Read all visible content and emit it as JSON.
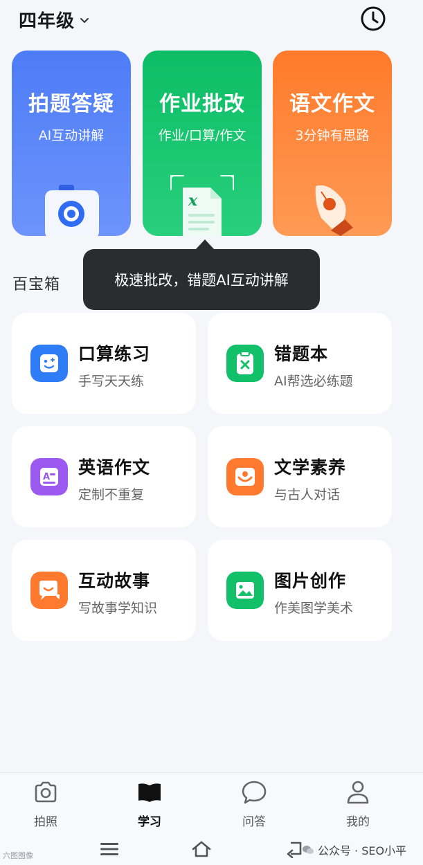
{
  "header": {
    "grade": "四年级",
    "chevron_icon": "chevron-down-icon",
    "history_icon": "clock-icon"
  },
  "features": [
    {
      "title": "拍题答疑",
      "subtitle": "AI互动讲解",
      "color": "#5a86f9",
      "icon": "camera-icon"
    },
    {
      "title": "作业批改",
      "subtitle": "作业/口算/作文",
      "color": "#17c46f",
      "icon": "scan-document-icon"
    },
    {
      "title": "语文作文",
      "subtitle": "3分钟有思路",
      "color": "#ff8438",
      "icon": "pen-nib-icon"
    }
  ],
  "tooltip": {
    "text": "极速批改，错题AI互动讲解"
  },
  "section": {
    "title": "百宝箱"
  },
  "tools": [
    {
      "title": "口算练习",
      "subtitle": "手写天天练",
      "color": "#2e7cf6",
      "icon": "smile-face-icon"
    },
    {
      "title": "错题本",
      "subtitle": "AI帮选必练题",
      "color": "#12c06a",
      "icon": "clipboard-x-icon"
    },
    {
      "title": "英语作文",
      "subtitle": "定制不重复",
      "color": "#9b59f0",
      "icon": "letter-a-icon"
    },
    {
      "title": "文学素养",
      "subtitle": "与古人对话",
      "color": "#ff7a2e",
      "icon": "book-open-icon"
    },
    {
      "title": "互动故事",
      "subtitle": "写故事学知识",
      "color": "#ff7a2e",
      "icon": "chat-bubbles-icon"
    },
    {
      "title": "图片创作",
      "subtitle": "作美图学美术",
      "color": "#12c06a",
      "icon": "image-icon"
    }
  ],
  "tabbar": {
    "items": [
      {
        "label": "拍照",
        "icon": "camera-icon",
        "active": false
      },
      {
        "label": "学习",
        "icon": "book-icon",
        "active": true
      },
      {
        "label": "问答",
        "icon": "chat-icon",
        "active": false
      },
      {
        "label": "我的",
        "icon": "person-icon",
        "active": false
      }
    ]
  },
  "watermarks": {
    "left": "六图图像",
    "right": "公众号 · SEO小平"
  }
}
